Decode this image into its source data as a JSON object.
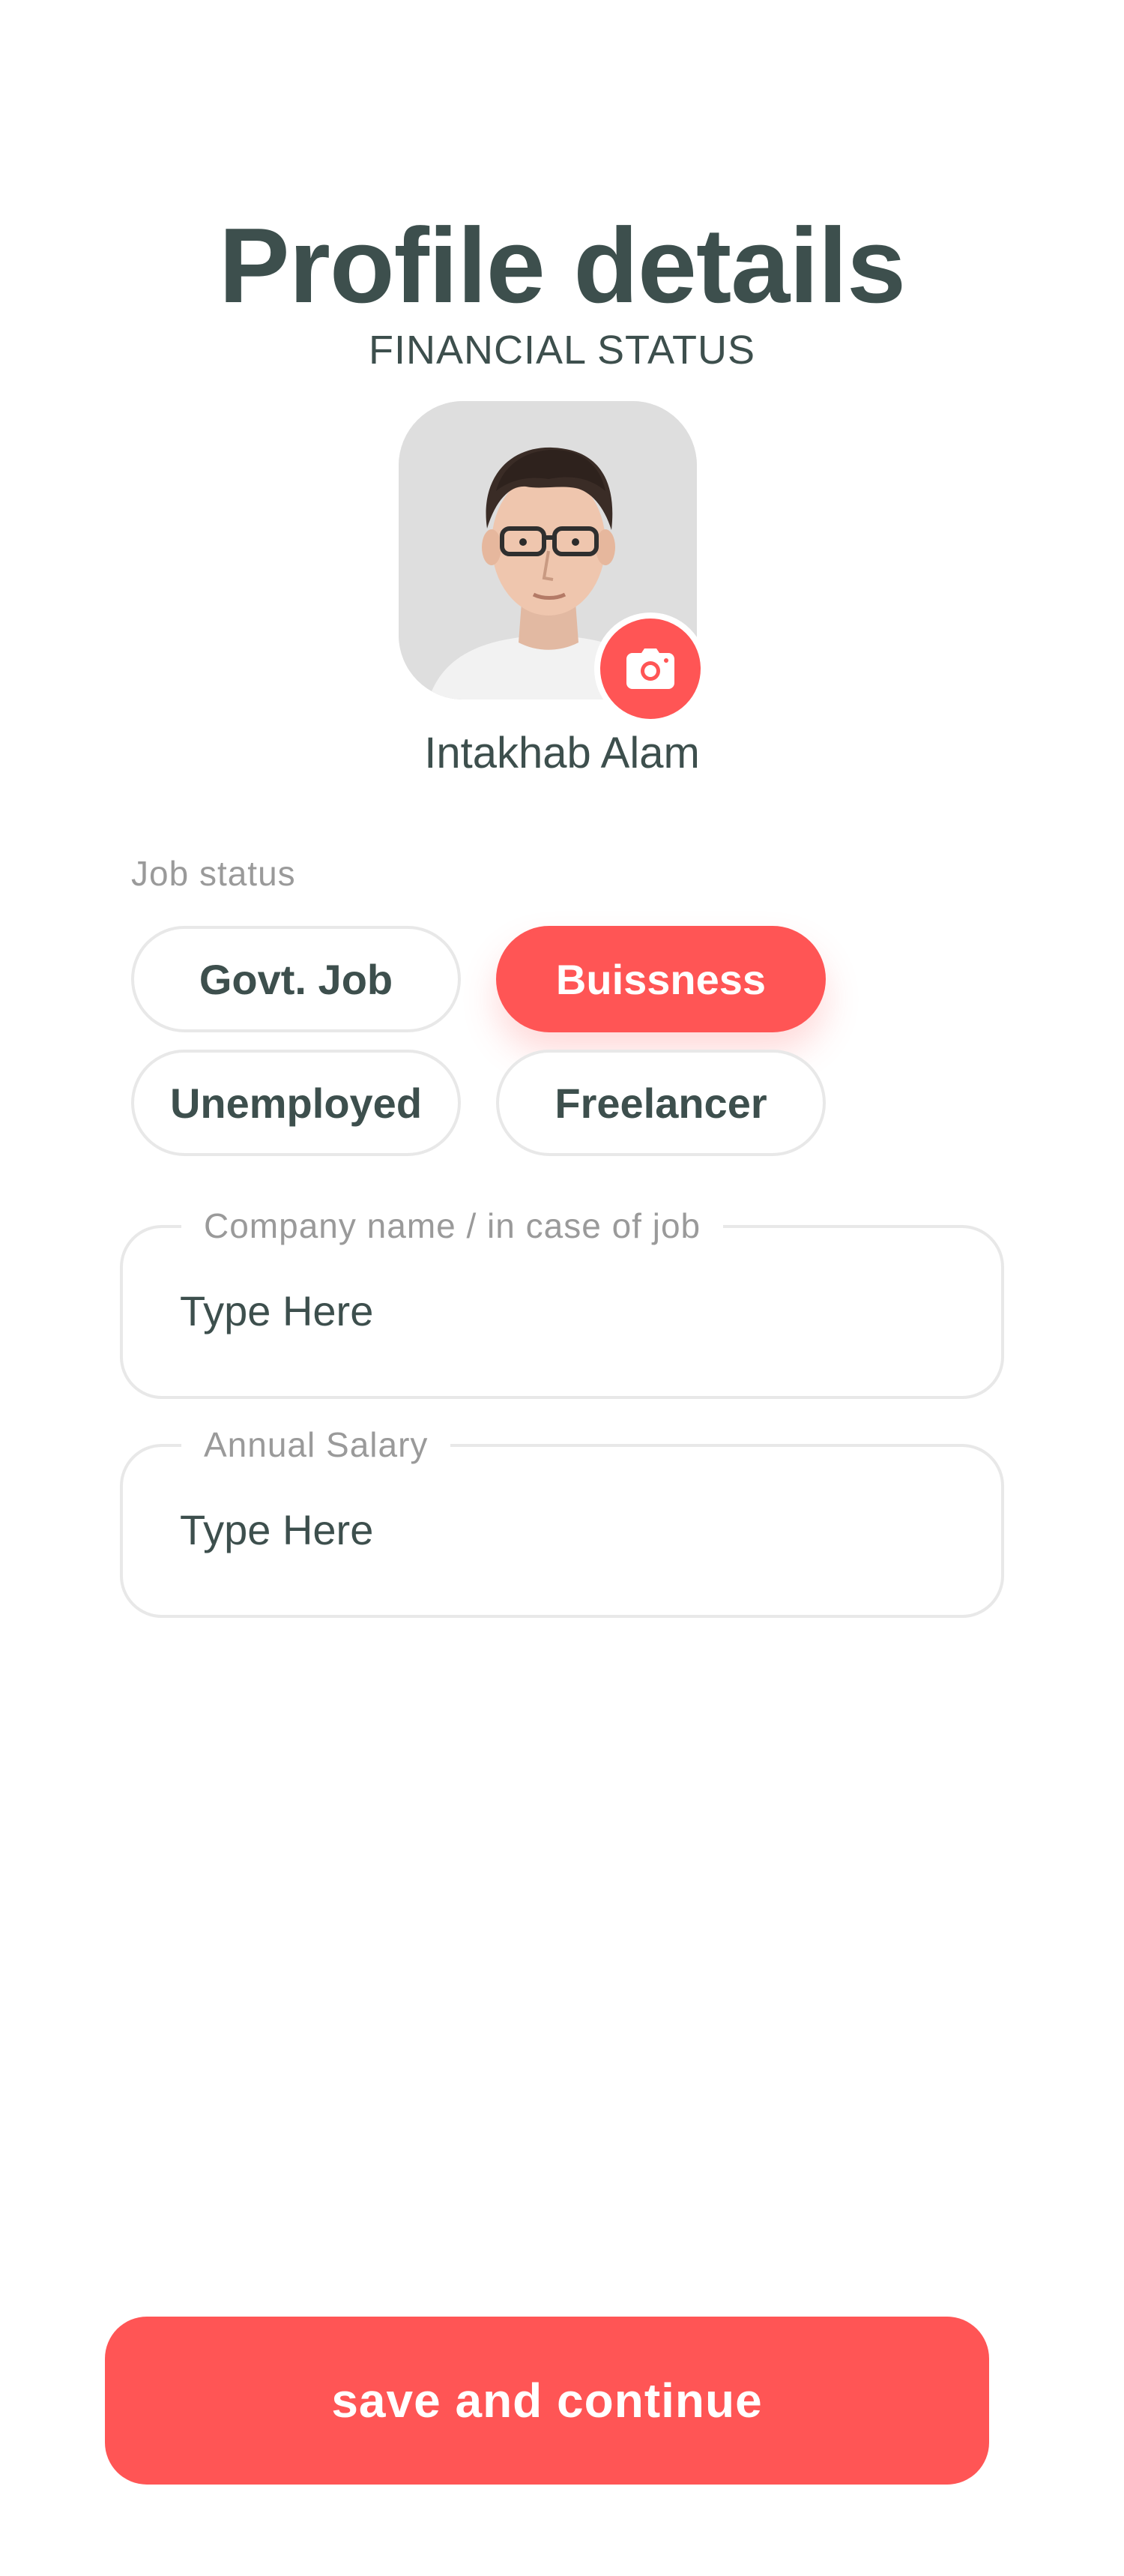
{
  "header": {
    "title": "Profile details",
    "subtitle": "FINANCIAL STATUS"
  },
  "profile": {
    "name": "Intakhab Alam",
    "avatar_icon": "user-photo",
    "camera_icon": "camera-icon"
  },
  "job_status": {
    "label": "Job  status",
    "options": [
      "Govt. Job",
      "Buissness",
      "Unemployed",
      "Freelancer"
    ],
    "selected": "Buissness"
  },
  "fields": {
    "company": {
      "label": "Company name / in case of job",
      "placeholder": "Type Here",
      "value": ""
    },
    "salary": {
      "label": "Annual  Salary",
      "placeholder": "Type Here",
      "value": ""
    }
  },
  "actions": {
    "save_label": "save and continue"
  },
  "colors": {
    "accent": "#ff5555",
    "text": "#3d4f4d",
    "muted": "#9a9a9a",
    "border": "#e8e8e8"
  }
}
